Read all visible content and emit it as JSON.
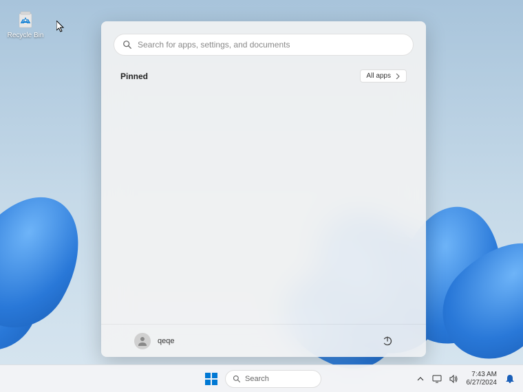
{
  "desktop": {
    "recycle_bin_label": "Recycle Bin"
  },
  "start_menu": {
    "search_placeholder": "Search for apps, settings, and documents",
    "pinned_title": "Pinned",
    "all_apps_label": "All apps",
    "user_name": "qeqe"
  },
  "taskbar": {
    "search_label": "Search",
    "time": "7:43 AM",
    "date": "6/27/2024"
  },
  "icons": {
    "search": "search-icon",
    "chevron_right": "chevron-right-icon",
    "avatar": "avatar-icon",
    "power": "power-icon",
    "start": "start-icon",
    "chevron_up": "chevron-up-icon",
    "monitor": "monitor-icon",
    "speaker": "speaker-icon",
    "notification": "notification-icon",
    "recycle_bin": "recycle-bin-icon"
  }
}
